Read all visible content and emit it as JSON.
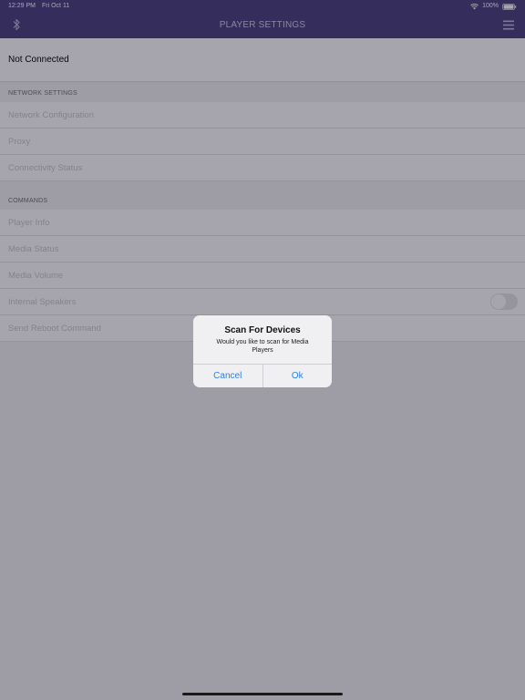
{
  "status_bar": {
    "time": "12:29 PM",
    "date": "Fri Oct 11",
    "battery": "100%",
    "wifi_icon": "wifi-icon",
    "battery_icon": "battery-icon"
  },
  "nav": {
    "title": "PLAYER SETTINGS",
    "left_icon": "bluetooth-icon",
    "right_icon": "menu-icon",
    "background_color": "#4a3f7e"
  },
  "connection": {
    "status": "Not Connected"
  },
  "sections": {
    "network": {
      "header": "NETWORK SETTINGS",
      "items": [
        "Network Configuration",
        "Proxy",
        "Connectivity Status"
      ]
    },
    "commands": {
      "header": "COMMANDS",
      "items": [
        "Player Info",
        "Media Status",
        "Media Volume",
        "Internal Speakers",
        "Send Reboot Command"
      ]
    }
  },
  "alert": {
    "title": "Scan For Devices",
    "message": "Would you like to scan for Media Players",
    "cancel_label": "Cancel",
    "ok_label": "Ok",
    "button_color": "#2f7fe0"
  }
}
